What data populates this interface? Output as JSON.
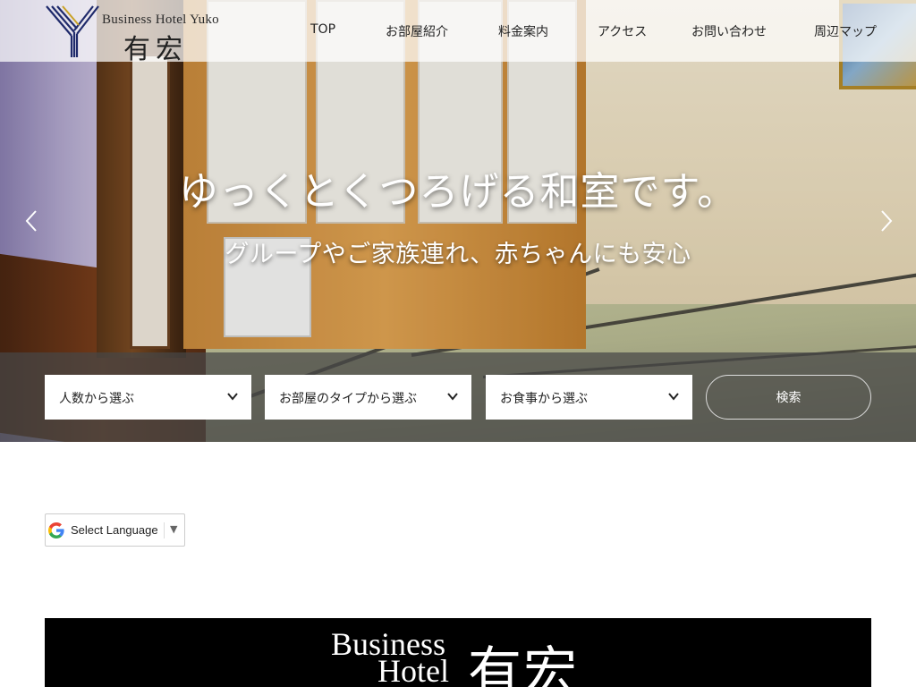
{
  "header": {
    "logo_en": "Business Hotel Yuko",
    "logo_jp": "有宏",
    "nav": [
      {
        "label": "TOP"
      },
      {
        "label": "お部屋紹介"
      },
      {
        "label": "料金案内"
      },
      {
        "label": "アクセス"
      },
      {
        "label": "お問い合わせ"
      },
      {
        "label": "周辺マップ"
      }
    ]
  },
  "hero": {
    "title": "ゆっくとくつろげる和室です。",
    "subtitle": "グループやご家族連れ、赤ちゃんにも安心",
    "prev_icon": "chevron-left-icon",
    "next_icon": "chevron-right-icon"
  },
  "search": {
    "guests_select": "人数から選ぶ",
    "room_type_select": "お部屋のタイプから選ぶ",
    "meal_select": "お食事から選ぶ",
    "search_button": "検索"
  },
  "translate": {
    "label": "Select Language",
    "caret": "▼",
    "icon": "google-g-icon"
  },
  "banner": {
    "title_en_line1": "Business",
    "title_en_line2": "Hotel",
    "title_jp": "有宏"
  },
  "colors": {
    "header_bg": "#ffffff",
    "search_bar_bg": "#464646",
    "logo_navy": "#1f2a6b",
    "banner_bg": "#000000"
  }
}
